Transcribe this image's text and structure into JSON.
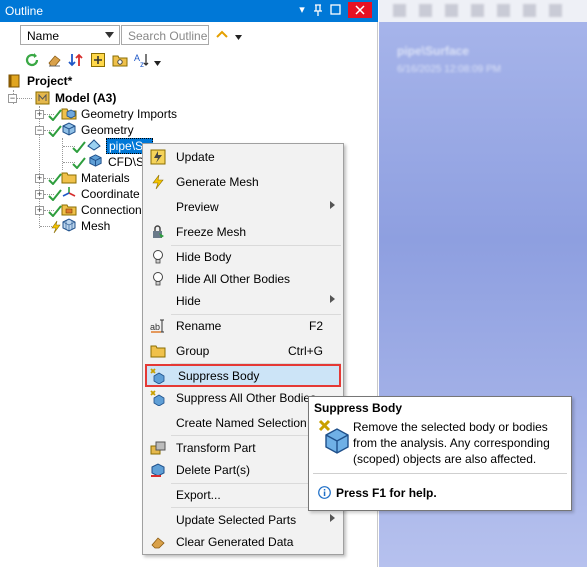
{
  "window": {
    "title": "Outline",
    "pin_glyph": "▾",
    "pushpin_glyph": "⊥",
    "maximize_glyph": "□",
    "close_glyph": "×"
  },
  "toolbar": {
    "filter_value": "Name",
    "search_placeholder": "Search Outline"
  },
  "tree": {
    "project": "Project*",
    "model": "Model (A3)",
    "geometry_imports": "Geometry Imports",
    "geometry": "Geometry",
    "body1": "pipe\\Su",
    "body2": "CFD\\Sc",
    "materials": "Materials",
    "coordinate": "Coordinate S",
    "connections": "Connections",
    "mesh": "Mesh"
  },
  "right_panel": {
    "heading": "pipe\\Surface",
    "timestamp": "6/16/2025 12:08:09 PM"
  },
  "context_menu": {
    "update": "Update",
    "generate_mesh": "Generate Mesh",
    "preview": "Preview",
    "freeze_mesh": "Freeze Mesh",
    "hide_body": "Hide Body",
    "hide_all_other": "Hide All Other Bodies",
    "hide": "Hide",
    "rename": "Rename",
    "rename_shortcut": "F2",
    "group": "Group",
    "group_shortcut": "Ctrl+G",
    "suppress_body": "Suppress Body",
    "suppress_all_other": "Suppress All Other Bodies",
    "create_named_selection": "Create Named Selection",
    "transform_part": "Transform Part",
    "delete_parts": "Delete Part(s)",
    "export": "Export...",
    "update_selected_parts": "Update Selected Parts",
    "clear_generated_data": "Clear Generated Data"
  },
  "tooltip": {
    "title": "Suppress Body",
    "body": "Remove the selected body or bodies from the analysis. Any corresponding (scoped) objects are also affected.",
    "help": "Press F1 for help."
  },
  "colors": {
    "accent": "#0078d7",
    "highlight": "#cce4f7",
    "highlight_border": "#e53935",
    "check": "#2e9e3e"
  }
}
